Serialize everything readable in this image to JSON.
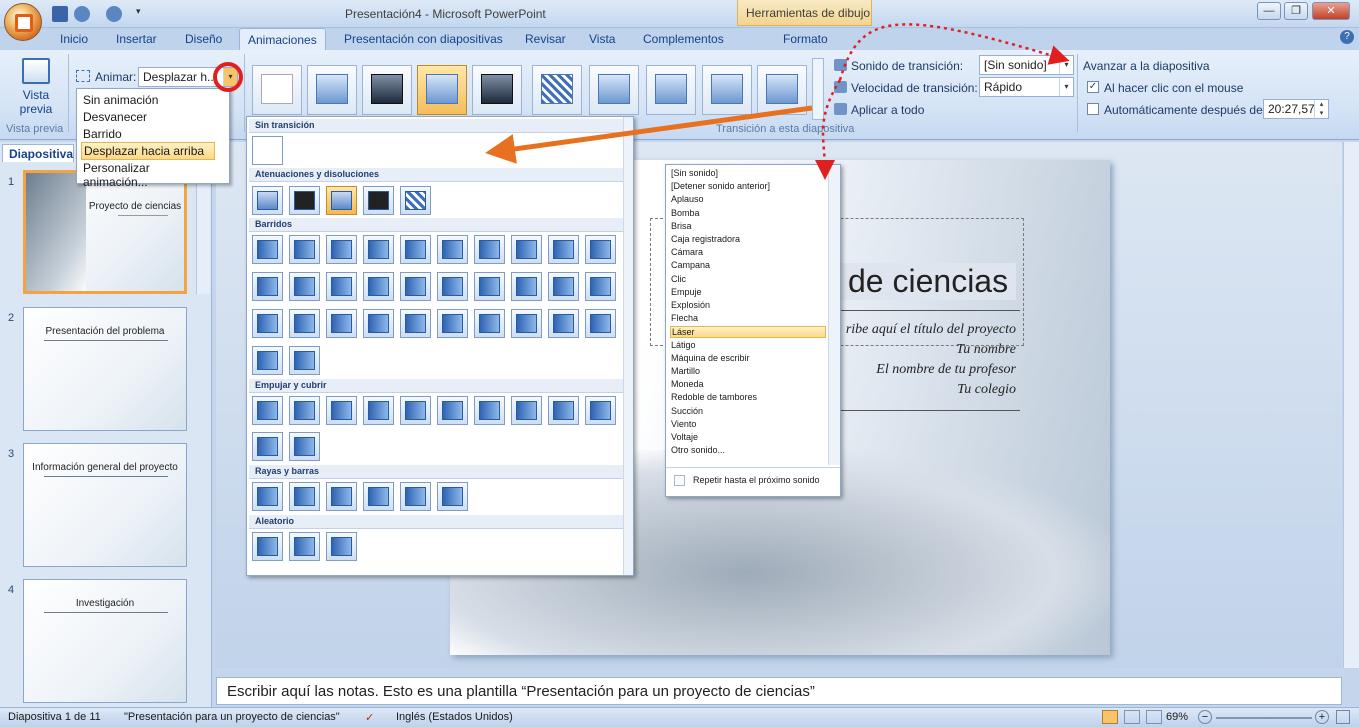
{
  "window": {
    "title": "Presentación4 - Microsoft PowerPoint",
    "context_tab": "Herramientas de dibujo",
    "minimize": "—",
    "maximize": "❐",
    "close": "✕"
  },
  "tabs": [
    "Inicio",
    "Insertar",
    "Diseño",
    "Animaciones",
    "Presentación con diapositivas",
    "Revisar",
    "Vista",
    "Complementos",
    "Formato"
  ],
  "active_tab": "Animaciones",
  "ribbon": {
    "preview_label_1": "Vista",
    "preview_label_2": "previa",
    "preview_group": "Vista previa",
    "animar_label": "Animar:",
    "animar_value": "Desplazar h...",
    "transition_group": "Transición a esta diapositiva",
    "sound_label": "Sonido de transición:",
    "sound_value": "[Sin sonido]",
    "speed_label": "Velocidad de transición:",
    "speed_value": "Rápido",
    "apply_all": "Aplicar a todo",
    "advance_title": "Avanzar a la diapositiva",
    "on_click": "Al hacer clic con el mouse",
    "on_click_checked": "✓",
    "auto_after": "Automáticamente después de:",
    "auto_time": "20:27,57"
  },
  "animate_menu": {
    "items": [
      "Sin animación",
      "Desvanecer",
      "Barrido",
      "Desplazar hacia arriba",
      "Personalizar animación..."
    ],
    "selected": "Desplazar hacia arriba"
  },
  "gallery": {
    "sections": [
      "Sin transición",
      "Atenuaciones y disoluciones",
      "Barridos",
      "Empujar y cubrir",
      "Rayas y barras",
      "Aleatorio"
    ]
  },
  "sound_menu": {
    "items": [
      "[Sin sonido]",
      "[Detener sonido anterior]",
      "Aplauso",
      "Bomba",
      "Brisa",
      "Caja registradora",
      "Cámara",
      "Campana",
      "Clic",
      "Empuje",
      "Explosión",
      "Flecha",
      "Láser",
      "Látigo",
      "Máquina de escribir",
      "Martillo",
      "Moneda",
      "Redoble de tambores",
      "Succión",
      "Viento",
      "Voltaje",
      "Otro sonido..."
    ],
    "selected": "Láser",
    "repeat": "Repetir hasta el próximo sonido"
  },
  "left_pane": {
    "tab": "Diapositiva",
    "slides": [
      {
        "num": "1",
        "title": "Proyecto de ciencias"
      },
      {
        "num": "2",
        "title": "Presentación del problema"
      },
      {
        "num": "3",
        "title": "Información general del proyecto"
      },
      {
        "num": "4",
        "title": "Investigación"
      }
    ]
  },
  "slide": {
    "title_partial": "de ciencias",
    "subtitle": "ribe aquí el título del proyecto",
    "name": "Tu nombre",
    "teacher": "El nombre de tu profesor",
    "school": "Tu colegio"
  },
  "notes": "Escribir aquí las notas. Esto es una plantilla “Presentación para un proyecto de ciencias”",
  "status": {
    "slide": "Diapositiva 1 de 11",
    "template": "\"Presentación para un proyecto de ciencias\"",
    "language": "Inglés (Estados Unidos)",
    "zoom": "69%"
  },
  "colors": {
    "accent": "#f1a441",
    "annotation_orange": "#e8711f",
    "annotation_red": "#e02020"
  }
}
